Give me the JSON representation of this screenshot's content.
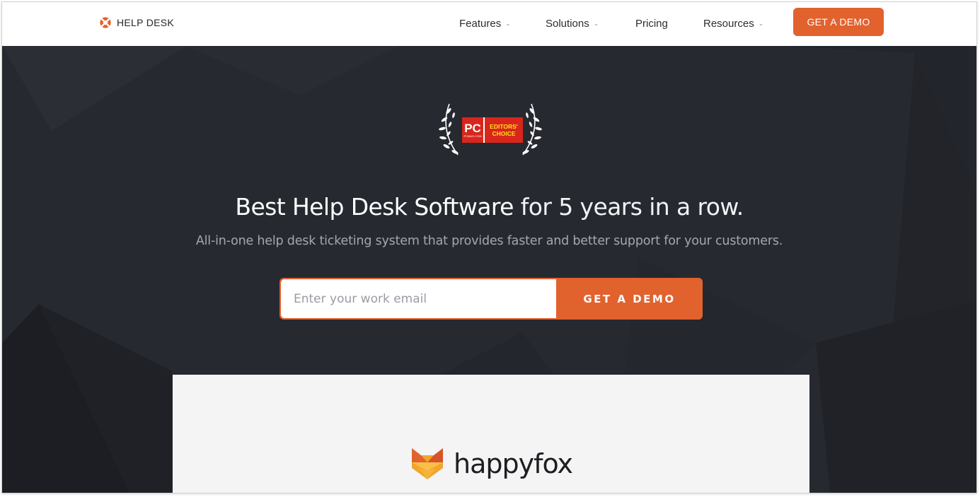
{
  "nav": {
    "brand": "HELP DESK",
    "items": [
      {
        "label": "Features",
        "has_dropdown": true
      },
      {
        "label": "Solutions",
        "has_dropdown": true
      },
      {
        "label": "Pricing",
        "has_dropdown": false
      },
      {
        "label": "Resources",
        "has_dropdown": true
      }
    ],
    "chevron": "⌄",
    "cta": "GET A DEMO"
  },
  "award": {
    "pc": "PC",
    "site": "PCMAG.COM",
    "line1": "EDITORS'",
    "line2": "CHOICE",
    "icon": "laurel-wreath-icon"
  },
  "hero": {
    "headline_strong": "Best Help Desk Software",
    "headline_rest": " for 5 years in a row.",
    "subline": "All-in-one help desk ticketing system that provides faster and better support for your customers.",
    "email_placeholder": "Enter your work email",
    "cta": "GET A DEMO"
  },
  "preview": {
    "logo_name": "happyfox",
    "logo_icon": "fox-icon"
  },
  "colors": {
    "accent": "#e2622e",
    "hero_bg": "#272931",
    "nav_bg": "#ffffff"
  }
}
